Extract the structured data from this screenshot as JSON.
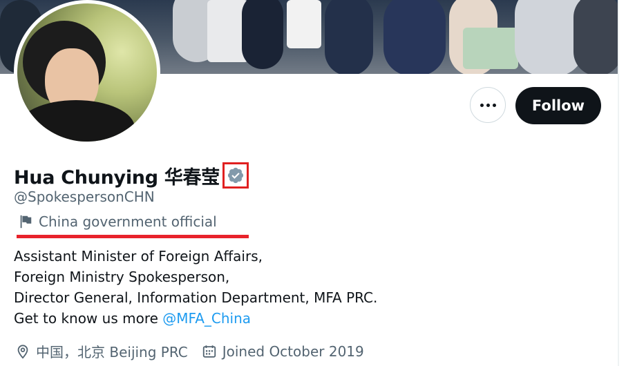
{
  "profile": {
    "display_name": "Hua Chunying 华春莹",
    "handle": "@SpokespersonCHN",
    "affiliation": "China government official",
    "bio_lines": [
      "Assistant Minister of Foreign Affairs,",
      "Foreign Ministry Spokesperson,",
      "Director General, Information Department, MFA PRC."
    ],
    "bio_last_prefix": "Get to know us more ",
    "bio_mention": "@MFA_China",
    "location": "中国，北京 Beijing PRC",
    "joined": "Joined October 2019"
  },
  "actions": {
    "follow_label": "Follow",
    "more_icon": "more-horizontal-icon"
  },
  "icons": {
    "verified": "verified-badge-icon",
    "affiliation": "flag-icon",
    "location": "location-pin-icon",
    "joined": "calendar-icon"
  },
  "colors": {
    "text_primary": "#0f1419",
    "text_secondary": "#536471",
    "link": "#1d9bf0",
    "verified_badge": "#829aab",
    "annotation_red": "#e8232b",
    "follow_bg": "#0f1419"
  }
}
